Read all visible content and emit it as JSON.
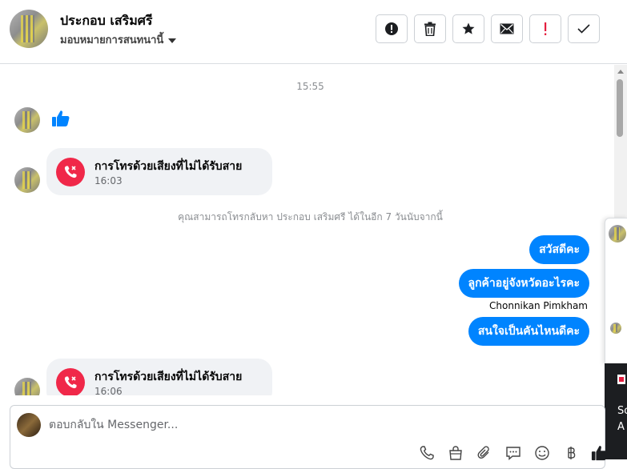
{
  "header": {
    "contact_name": "ประกอบ เสริมศรี",
    "assign_label": "มอบหมายการสนทนานี้",
    "toolbar": [
      {
        "icon": "alert-circle-icon"
      },
      {
        "icon": "trash-icon"
      },
      {
        "icon": "star-icon"
      },
      {
        "icon": "envelope-icon"
      },
      {
        "icon": "exclamation-icon",
        "color": "#e41e3f"
      },
      {
        "icon": "check-icon"
      }
    ]
  },
  "conversation": {
    "timestamp": "15:55",
    "missed_call_1": {
      "title": "การโทรด้วยเสียงที่ไม่ได้รับสาย",
      "time": "16:03"
    },
    "callback_notice": "คุณสามารถโทรกลับหา ประกอบ เสริมศรี ได้ในอีก 7 วันนับจากนี้",
    "outgoing": [
      "สวัสดีคะ",
      "ลูกค้าอยู่จังหวัดอะไรคะ",
      "สนใจเป็นคันไหนดีคะ"
    ],
    "sender_name": "Chonnikan Pimkham",
    "missed_call_2": {
      "title": "การโทรด้วยเสียงที่ไม่ได้รับสาย",
      "time": "16:06"
    }
  },
  "side_panel": {
    "line1": "So",
    "line2": "A"
  },
  "composer": {
    "placeholder": "ตอบกลับใน Messenger...",
    "tools": [
      "phone-icon",
      "shopping-bag-icon",
      "paperclip-icon",
      "saved-reply-icon",
      "emoji-icon",
      "baht-icon",
      "thumbs-up-icon"
    ]
  },
  "colors": {
    "accent": "#0084ff",
    "missed_call": "#f02849",
    "bubble_in": "#f0f2f5"
  }
}
